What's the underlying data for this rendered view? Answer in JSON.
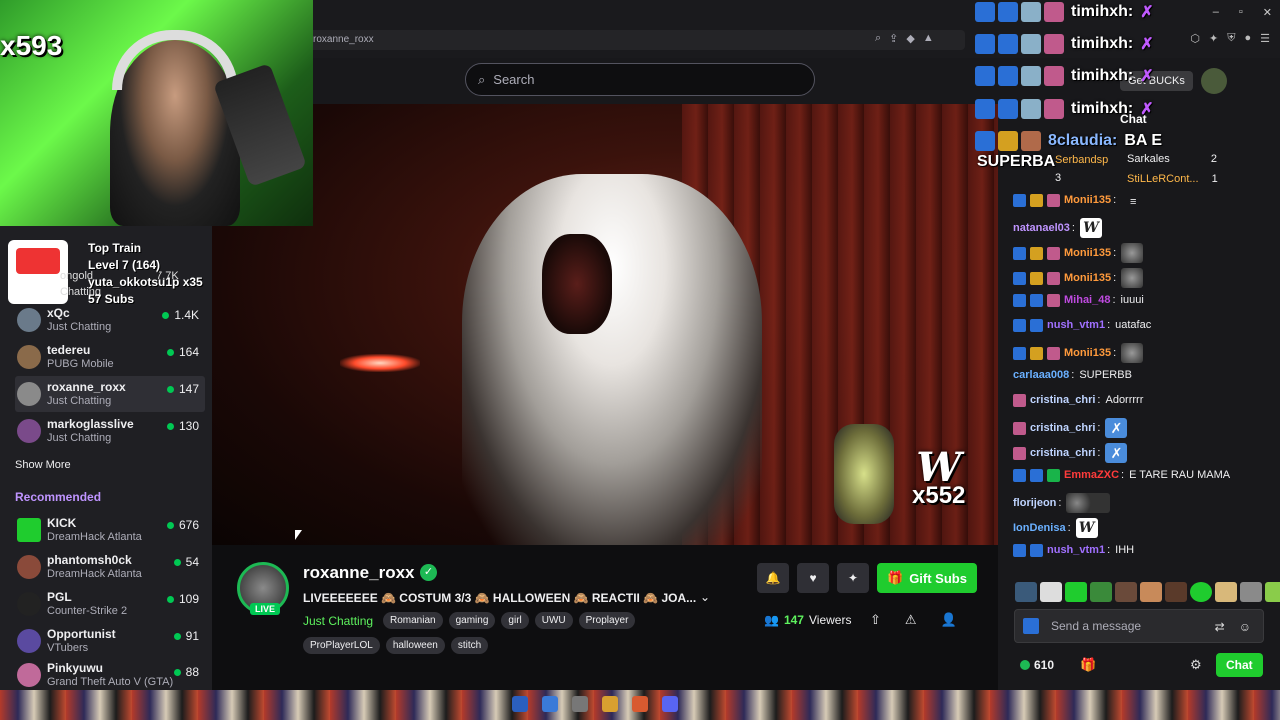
{
  "browser": {
    "tab_url": "roxanne_roxx",
    "search_placeholder": "Search",
    "get_bucks": "Get BUCKs"
  },
  "webcam": {
    "counter": "x593"
  },
  "train": {
    "title": "Top Train",
    "level": "Level 7 (164)",
    "user": "yuta_okkotsu1p x35",
    "subs": "57 Subs",
    "under_name": "ongold",
    "under_viewers": "7.7K",
    "under_game": "Chatting"
  },
  "sidebar": {
    "followed": [
      {
        "name": "xQc",
        "game": "Just Chatting",
        "viewers": "1.4K",
        "color": "#6a7a8a"
      },
      {
        "name": "tedereu",
        "game": "PUBG Mobile",
        "viewers": "164",
        "color": "#8a6a4a"
      },
      {
        "name": "roxanne_roxx",
        "game": "Just Chatting",
        "viewers": "147",
        "color": "#8a8a8a"
      },
      {
        "name": "markoglasslive",
        "game": "Just Chatting",
        "viewers": "130",
        "color": "#7a4a8a"
      }
    ],
    "show_more": "Show More",
    "recommended_label": "Recommended",
    "recommended": [
      {
        "name": "KICK",
        "game": "DreamHack Atlanta",
        "viewers": "676",
        "color": "#1fcc2e"
      },
      {
        "name": "phantomsh0ck",
        "game": "DreamHack Atlanta",
        "viewers": "54",
        "color": "#8a4a3a"
      },
      {
        "name": "PGL",
        "game": "Counter-Strike 2",
        "viewers": "109",
        "color": "#222222"
      },
      {
        "name": "Opportunist",
        "game": "VTubers",
        "viewers": "91",
        "color": "#5a4aa0"
      },
      {
        "name": "Pinkyuwu",
        "game": "Grand Theft Auto V (GTA)",
        "viewers": "88",
        "color": "#c06a9a"
      }
    ]
  },
  "video": {
    "overlay_counter": "x552",
    "overlay_logo": "W"
  },
  "channel": {
    "name": "roxanne_roxx",
    "live_label": "LIVE",
    "title": "LIVEEEEEEE 🙈 COSTUM 3/3 🙈 HALLOWEEN 🙈 REACTII 🙈 JOA...",
    "category": "Just Chatting",
    "tags": [
      "Romanian",
      "gaming",
      "girl",
      "UWU",
      "Proplayer"
    ],
    "tags2": [
      "ProPlayerLOL",
      "halloween",
      "stitch"
    ],
    "viewers_count": "147",
    "viewers_label": "Viewers",
    "gift_subs": "Gift Subs"
  },
  "overlay_chat": [
    {
      "user": "timihxh:",
      "emote": "✗"
    },
    {
      "user": "timihxh:",
      "emote": "✗"
    },
    {
      "user": "timihxh:",
      "emote": "✗"
    },
    {
      "user": "timihxh:",
      "emote": "✗"
    },
    {
      "user": "8claudia:",
      "emote": "BA E"
    }
  ],
  "overlay_superba": "SUPERBA",
  "chat": {
    "header": "Chat",
    "leaderboard": [
      {
        "name": "Serbandsp",
        "count": "3"
      },
      {
        "name": "Sarkales",
        "count": "2"
      },
      {
        "name": "StiLLeRCont...",
        "count": "1"
      }
    ],
    "messages": [
      {
        "user": "Monii135",
        "color": "#ff9a3c",
        "text": ""
      },
      {
        "user": "natanael03",
        "color": "#bf94ff",
        "text": "",
        "emote": "w"
      },
      {
        "user": "Monii135",
        "color": "#ff9a3c",
        "text": "",
        "emote": "monkey"
      },
      {
        "user": "Monii135",
        "color": "#ff9a3c",
        "text": "",
        "emote": "monkey"
      },
      {
        "user": "Mihai_48",
        "color": "#bf4ae0",
        "text": "iuuui"
      },
      {
        "user": "nush_vtm1",
        "color": "#a070ff",
        "text": "uatafac"
      },
      {
        "user": "Monii135",
        "color": "#ff9a3c",
        "text": "",
        "emote": "monkey"
      },
      {
        "user": "carlaaa008",
        "color": "#6ab0ff",
        "text": "SUPERBB"
      },
      {
        "user": "cristina_chri",
        "color": "#bfd4ff",
        "text": "Adorrrrr"
      },
      {
        "user": "cristina_chri",
        "color": "#bfd4ff",
        "text": "",
        "emote": "x"
      },
      {
        "user": "cristina_chri",
        "color": "#bfd4ff",
        "text": "",
        "emote": "x"
      },
      {
        "user": "EmmaZXC",
        "color": "#ff3b3b",
        "text": "E TARE RAU MAMA"
      },
      {
        "user": "florijeon",
        "color": "#bfd4ff",
        "text": "",
        "emote": "faces"
      },
      {
        "user": "IonDenisa",
        "color": "#6ab0ff",
        "text": "",
        "emote": "w"
      },
      {
        "user": "nush_vtm1",
        "color": "#a070ff",
        "text": "IHH"
      }
    ],
    "input_placeholder": "Send a message",
    "points": "610",
    "chat_button": "Chat"
  }
}
